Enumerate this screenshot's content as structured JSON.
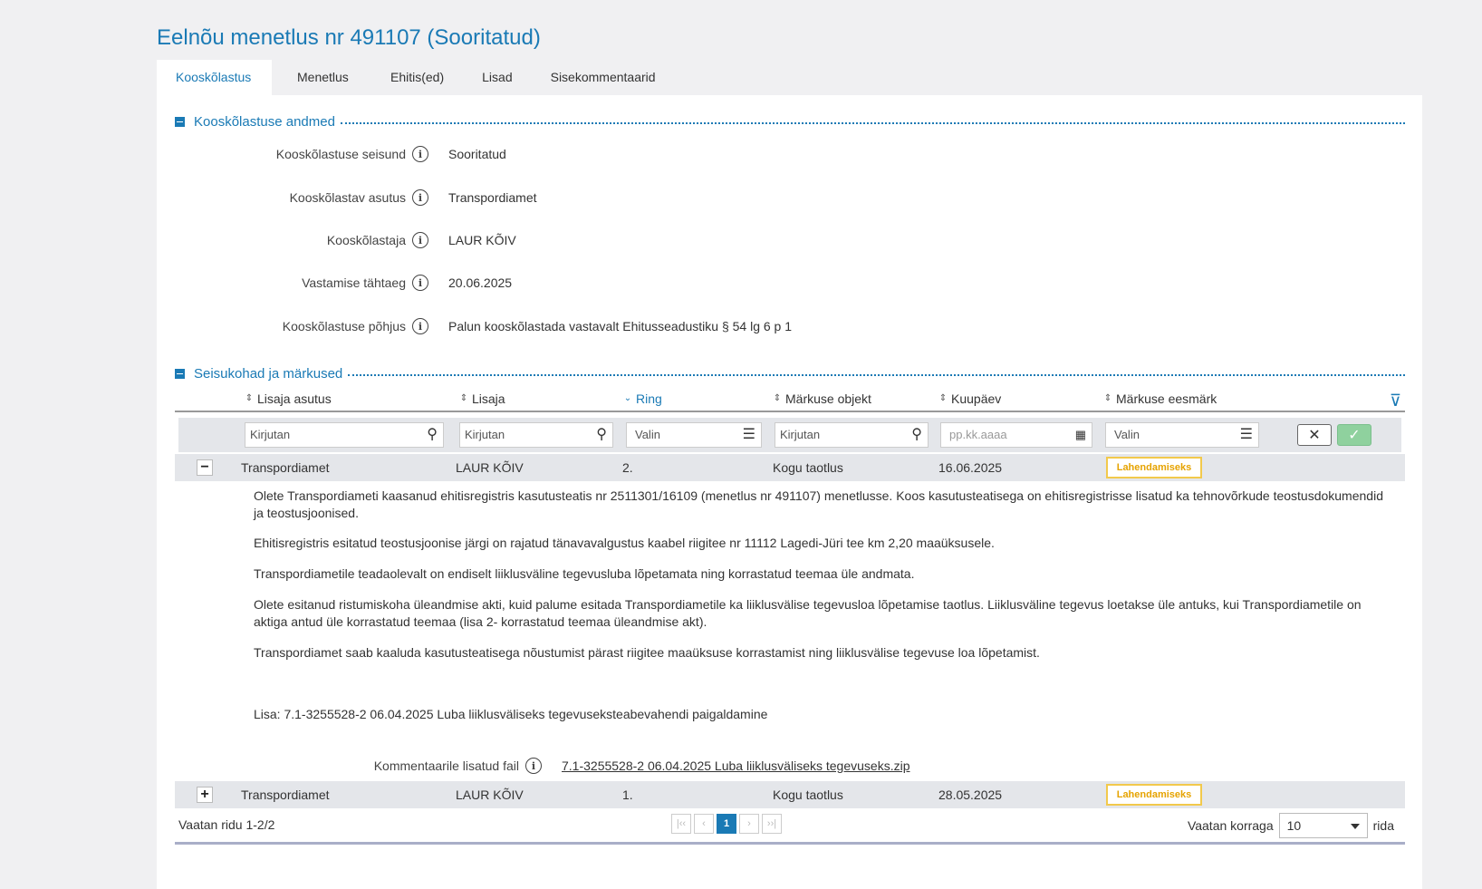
{
  "page": {
    "title": "Eelnõu menetlus nr 491107 (Sooritatud)"
  },
  "tabs": [
    {
      "label": "Kooskõlastus",
      "active": true
    },
    {
      "label": "Menetlus"
    },
    {
      "label": "Ehitis(ed)"
    },
    {
      "label": "Lisad"
    },
    {
      "label": "Sisekommentaarid"
    }
  ],
  "section1": {
    "title": "Kooskõlastuse andmed",
    "fields": [
      {
        "label": "Kooskõlastuse seisund",
        "value": "Sooritatud"
      },
      {
        "label": "Kooskõlastav asutus",
        "value": "Transpordiamet"
      },
      {
        "label": "Kooskõlastaja",
        "value": "LAUR KÕIV"
      },
      {
        "label": "Vastamise tähtaeg",
        "value": "20.06.2025"
      },
      {
        "label": "Kooskõlastuse põhjus",
        "value": "Palun kooskõlastada vastavalt Ehitusseadustiku § 54 lg 6 p 1"
      }
    ]
  },
  "section2": {
    "title": "Seisukohad ja märkused",
    "columns": [
      "Lisaja asutus",
      "Lisaja",
      "Ring",
      "Märkuse objekt",
      "Kuupäev",
      "Märkuse eesmärk"
    ],
    "filters": {
      "lisaja_asutus": "Kirjutan",
      "lisaja": "Kirjutan",
      "ring": "Valin",
      "objekt": "Kirjutan",
      "kuupaev": "pp.kk.aaaa",
      "eesmark": "Valin"
    },
    "rows": [
      {
        "toggle": "−",
        "asutus": "Transpordiamet",
        "lisaja": "LAUR KÕIV",
        "ring": "2.",
        "objekt": "Kogu taotlus",
        "kuupaev": "16.06.2025",
        "eesmark": "Lahendamiseks",
        "details": [
          "Olete Transpordiameti kaasanud ehitisregistris kasutusteatis nr 2511301/16109 (menetlus nr 491107) menetlusse. Koos kasutusteatisega on ehitisregistrisse lisatud ka tehnovõrkude teostusdokumendid ja teostusjoonised.",
          "Ehitisregistris esitatud teostusjoonise järgi on rajatud tänavavalgustus kaabel riigitee nr 11112 Lagedi-Jüri tee km 2,20 maaüksusele.",
          "Transpordiametile teadaolevalt on endiselt liiklusväline tegevusluba lõpetamata ning korrastatud teemaa üle andmata.",
          "Olete esitanud ristumiskoha üleandmise akti, kuid palume esitada Transpordiametile ka liiklusvälise tegevusloa lõpetamise taotlus. Liiklusväline tegevus loetakse üle antuks, kui Transpordiametile on aktiga antud üle korrastatud teemaa (lisa 2- korrastatud teemaa üleandmise akt).",
          "Transpordiamet saab kaaluda kasutusteatisega nõustumist pärast riigitee maaüksuse korrastamist ning liiklusvälise tegevuse loa lõpetamist.",
          "Lisa: 7.1-3255528-2 06.04.2025 Luba liiklusväliseks tegevuseksteabevahendi paigaldamine"
        ],
        "attachment_label": "Kommentaarile lisatud fail",
        "attachment_file": "7.1-3255528-2 06.04.2025 Luba liiklusväliseks tegevuseks.zip"
      },
      {
        "toggle": "+",
        "asutus": "Transpordiamet",
        "lisaja": "LAUR KÕIV",
        "ring": "1.",
        "objekt": "Kogu taotlus",
        "kuupaev": "28.05.2025",
        "eesmark": "Lahendamiseks"
      }
    ],
    "pager": {
      "rows_info": "Vaatan ridu 1-2/2",
      "current_page": "1",
      "per_page_label": "Vaatan korraga",
      "per_page_value": "10",
      "per_page_suffix": "rida"
    }
  },
  "icons": {
    "info": "info-icon",
    "search": "search-icon",
    "list": "list-icon",
    "calendar": "calendar-icon",
    "filter": "filter-icon"
  },
  "colors": {
    "accent": "#1a7ab5",
    "badge": "#f2c94c",
    "ok": "#8fd19e"
  }
}
